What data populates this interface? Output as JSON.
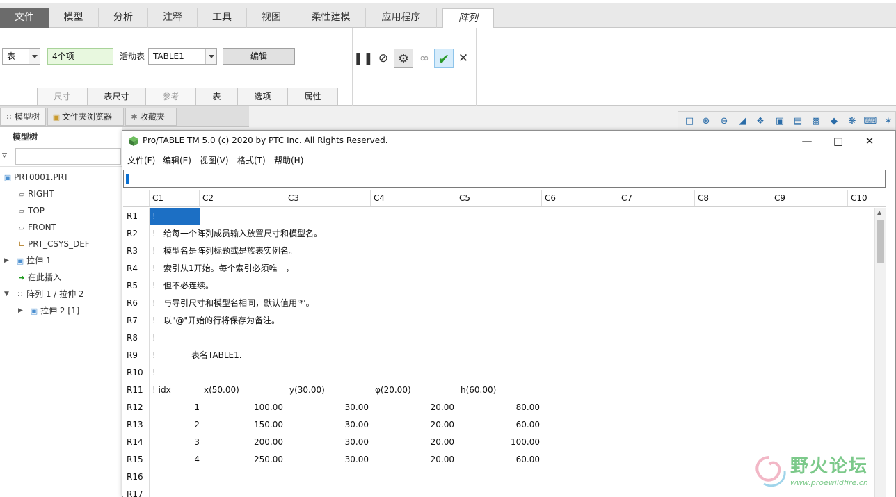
{
  "ribbon_tabs": [
    {
      "label": "文件"
    },
    {
      "label": "模型"
    },
    {
      "label": "分析"
    },
    {
      "label": "注释"
    },
    {
      "label": "工具"
    },
    {
      "label": "视图"
    },
    {
      "label": "柔性建模"
    },
    {
      "label": "应用程序"
    },
    {
      "label": "阵列"
    }
  ],
  "ribbon": {
    "type_value": "表",
    "item_count": "4个项",
    "active_table_label": "活动表",
    "active_table_value": "TABLE1",
    "edit_button": "编辑",
    "subtabs": [
      "尺寸",
      "表尺寸",
      "参考",
      "表",
      "选项",
      "属性"
    ],
    "controls": [
      "pause-icon",
      "stop-icon",
      "preview-icon",
      "glasses-icon",
      "check-icon",
      "close-icon"
    ]
  },
  "left_panel": {
    "tabs": [
      "模型树",
      "文件夹浏览器",
      "收藏夹"
    ],
    "title": "模型树",
    "tree": [
      {
        "label": "PRT0001.PRT",
        "icon": "part-icon"
      },
      {
        "label": "RIGHT",
        "icon": "datum-plane-icon"
      },
      {
        "label": "TOP",
        "icon": "datum-plane-icon"
      },
      {
        "label": "FRONT",
        "icon": "datum-plane-icon"
      },
      {
        "label": "PRT_CSYS_DEF",
        "icon": "csys-icon"
      },
      {
        "label": "拉伸 1",
        "icon": "extrude-icon"
      },
      {
        "label": "在此插入",
        "icon": "insert-arrow-icon"
      },
      {
        "label": "阵列 1 / 拉伸 2",
        "icon": "pattern-icon"
      },
      {
        "label": "拉伸 2 [1]",
        "icon": "extrude-icon"
      }
    ]
  },
  "dialog": {
    "title": "Pro/TABLE  TM  5.0  (c) 2020 by PTC Inc.  All Rights Reserved.",
    "menu": [
      "文件(F)",
      "编辑(E)",
      "视图(V)",
      "格式(T)",
      "帮助(H)"
    ],
    "edit_line": "!",
    "columns": [
      "C1",
      "C2",
      "C3",
      "C4",
      "C5",
      "C6",
      "C7",
      "C8",
      "C9",
      "C10"
    ],
    "rows": [
      {
        "id": "R1",
        "c1": "!",
        "text": ""
      },
      {
        "id": "R2",
        "c1": "!",
        "text": "给每一个阵列成员输入放置尺寸和模型名。"
      },
      {
        "id": "R3",
        "c1": "!",
        "text": "模型名是阵列标题或是族表实例名。"
      },
      {
        "id": "R4",
        "c1": "!",
        "text": "索引从1开始。每个索引必须唯一，"
      },
      {
        "id": "R5",
        "c1": "!",
        "text": "但不必连续。"
      },
      {
        "id": "R6",
        "c1": "!",
        "text": "与导引尺寸和模型名相同，默认值用'*'。"
      },
      {
        "id": "R7",
        "c1": "!",
        "text": "以\"@\"开始的行将保存为备注。"
      },
      {
        "id": "R8",
        "c1": "!",
        "text": ""
      },
      {
        "id": "R9",
        "c1": "!",
        "text": "表名TABLE1."
      },
      {
        "id": "R10",
        "c1": "!",
        "text": ""
      },
      {
        "id": "R11",
        "c1": "! idx",
        "headers": [
          "x(50.00)",
          "y(30.00)",
          "φ(20.00)",
          "h(60.00)"
        ]
      },
      {
        "id": "R12",
        "idx": "1",
        "vals": [
          "100.00",
          "30.00",
          "20.00",
          "80.00"
        ]
      },
      {
        "id": "R13",
        "idx": "2",
        "vals": [
          "150.00",
          "30.00",
          "20.00",
          "60.00"
        ]
      },
      {
        "id": "R14",
        "idx": "3",
        "vals": [
          "200.00",
          "30.00",
          "20.00",
          "100.00"
        ]
      },
      {
        "id": "R15",
        "idx": "4",
        "vals": [
          "250.00",
          "30.00",
          "20.00",
          "60.00"
        ]
      },
      {
        "id": "R16"
      },
      {
        "id": "R17"
      }
    ]
  },
  "watermark": {
    "big": "野火论坛",
    "small": "www.proewildfire.cn"
  }
}
